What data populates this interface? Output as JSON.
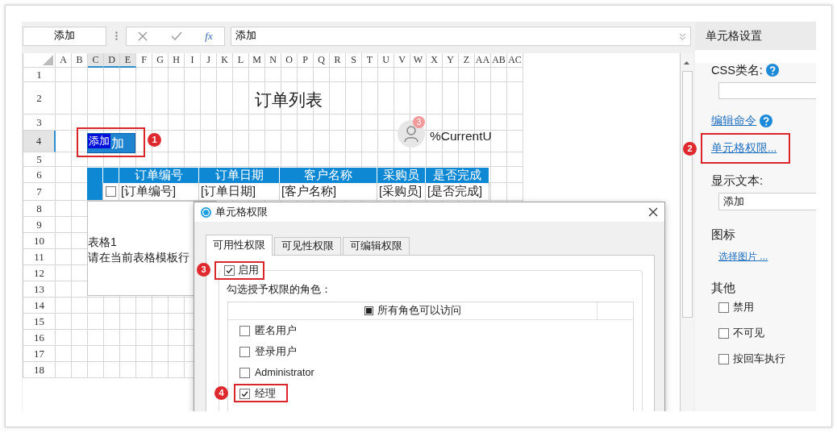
{
  "toolbar": {
    "name_box": "添加",
    "function_label": "fx",
    "formula": "添加"
  },
  "sheet": {
    "columns": [
      {
        "label": "A",
        "selected": false
      },
      {
        "label": "B",
        "selected": false
      },
      {
        "label": "C",
        "selected": true
      },
      {
        "label": "D",
        "selected": true
      },
      {
        "label": "E",
        "selected": true
      },
      {
        "label": "F",
        "selected": false
      },
      {
        "label": "G",
        "selected": false
      },
      {
        "label": "H",
        "selected": false
      },
      {
        "label": "I",
        "selected": false
      },
      {
        "label": "J",
        "selected": false
      },
      {
        "label": "K",
        "selected": false
      },
      {
        "label": "L",
        "selected": false
      },
      {
        "label": "M",
        "selected": false
      },
      {
        "label": "N",
        "selected": false
      },
      {
        "label": "O",
        "selected": false
      },
      {
        "label": "P",
        "selected": false
      },
      {
        "label": "Q",
        "selected": false
      },
      {
        "label": "R",
        "selected": false
      },
      {
        "label": "S",
        "selected": false
      },
      {
        "label": "T",
        "selected": false
      },
      {
        "label": "U",
        "selected": false
      },
      {
        "label": "V",
        "selected": false
      },
      {
        "label": "W",
        "selected": false
      },
      {
        "label": "X",
        "selected": false
      },
      {
        "label": "Y",
        "selected": false
      },
      {
        "label": "Z",
        "selected": false
      },
      {
        "label": "AA",
        "selected": false
      },
      {
        "label": "AB",
        "selected": false
      },
      {
        "label": "AC",
        "selected": false
      }
    ],
    "rows": [
      {
        "label": "1",
        "selected": false
      },
      {
        "label": "2",
        "selected": false
      },
      {
        "label": "3",
        "selected": false
      },
      {
        "label": "4",
        "selected": true
      },
      {
        "label": "5",
        "selected": false
      },
      {
        "label": "6",
        "selected": false
      },
      {
        "label": "7",
        "selected": false
      },
      {
        "label": "8",
        "selected": false
      },
      {
        "label": "9",
        "selected": false
      },
      {
        "label": "10",
        "selected": false
      },
      {
        "label": "11",
        "selected": false
      },
      {
        "label": "12",
        "selected": false
      },
      {
        "label": "13",
        "selected": false
      },
      {
        "label": "14",
        "selected": false
      },
      {
        "label": "15",
        "selected": false
      },
      {
        "label": "16",
        "selected": false
      },
      {
        "label": "17",
        "selected": false
      },
      {
        "label": "18",
        "selected": false
      }
    ]
  },
  "title": "订单列表",
  "button": {
    "editor_text": "添加",
    "label": "加",
    "callout": "1"
  },
  "user": {
    "badge": "3",
    "text": "%CurrentU"
  },
  "table": {
    "columns": [
      "订单编号",
      "订单日期",
      "客户名称",
      "采购员",
      "是否完成"
    ],
    "row": {
      "checked": false,
      "cells": [
        "[订单编号]",
        "[订单日期]",
        "[客户名称]",
        "[采购员]",
        "[是否完成]"
      ]
    }
  },
  "template": {
    "name": "表格1",
    "hint": "请在当前表格模板行"
  },
  "dialog": {
    "title": "单元格权限",
    "tabs": [
      {
        "label": "可用性权限",
        "selected": true
      },
      {
        "label": "可见性权限",
        "selected": false
      },
      {
        "label": "可编辑权限",
        "selected": false
      }
    ],
    "enable": {
      "label": "启用",
      "checked": true,
      "callout": "3"
    },
    "roles_label": "勾选授予权限的角色：",
    "all_roles": {
      "label": "所有角色可以访问",
      "indeterminate": true
    },
    "roles": [
      {
        "label": "匿名用户",
        "checked": false
      },
      {
        "label": "登录用户",
        "checked": false
      },
      {
        "label": "Administrator",
        "checked": false
      },
      {
        "label": "经理",
        "checked": true,
        "callout": "4"
      }
    ]
  },
  "panel": {
    "title": "单元格设置",
    "css_label": "CSS类名:",
    "edit_command": "编辑命令",
    "permissions": {
      "label": "单元格权限...",
      "callout": "2"
    },
    "display_text_label": "显示文本:",
    "display_text": "添加",
    "icon_label": "图标",
    "choose_image": "选择图片 ...",
    "other_label": "其他",
    "options": [
      {
        "label": "禁用",
        "checked": false
      },
      {
        "label": "不可见",
        "checked": false
      },
      {
        "label": "按回车执行",
        "checked": false
      }
    ]
  }
}
